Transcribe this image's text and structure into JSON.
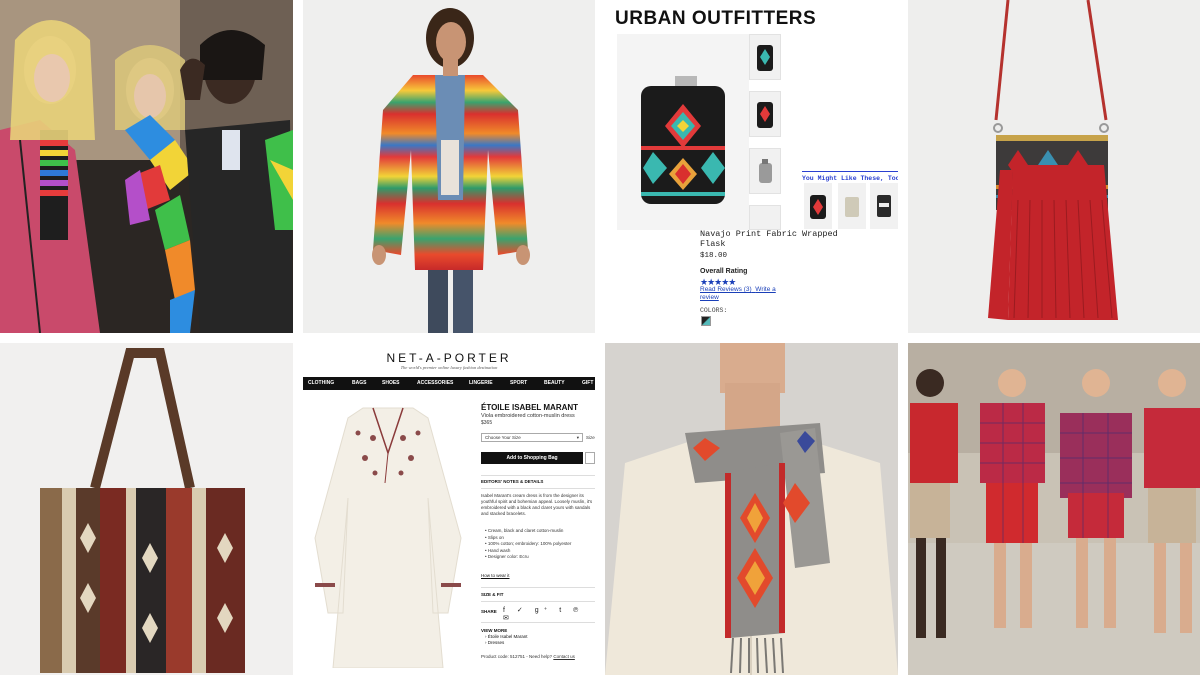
{
  "colors": {
    "uo_link_blue": "#1a3fb8",
    "nap_nav_bg": "#111111",
    "tote_stripe_red": "#7a2a22",
    "fringe_red": "#c3242a"
  },
  "urban_outfitters": {
    "logo": "URBAN OUTFITTERS",
    "product_name": "Navajo Print Fabric Wrapped Flask",
    "price": "$18.00",
    "rating_label": "Overall Rating",
    "stars": "★★★★★",
    "reviews_link": "Read Reviews (3)",
    "write_review_link": "Write a review",
    "colors_label": "COLORS:",
    "you_might_like": "You Might Like These, Too"
  },
  "net_a_porter": {
    "logo": "NET-A-PORTER",
    "tagline": "The world's premier online luxury fashion destination",
    "nav": [
      "CLOTHING",
      "BAGS",
      "SHOES",
      "ACCESSORIES",
      "LINGERIE",
      "SPORT",
      "BEAUTY",
      "GIFT"
    ],
    "brand": "ÉTOILE ISABEL MARANT",
    "description": "Viola embroidered cotton-muslin dress",
    "price": "$365",
    "size_select": "Choose Your Size",
    "size_label": "Size",
    "add_to_bag": "Add to Shopping Bag",
    "editors_notes": "EDITORS' NOTES & DETAILS",
    "body_text": "Isabel Marant's cream dress is from the designer its youthful spirit and bohemian appeal. Loosely muslin, it's embroidered with a black and claret yours with sandals and stacked bracelets.",
    "bullets": [
      "Cream, black and claret cotton-muslin",
      "Slips on",
      "100% cotton; embroidery: 100% polyester",
      "Hand wash",
      "Designer color: Ecru"
    ],
    "how_to_wear": "How to wear it",
    "size_fit": "SIZE & FIT",
    "share": "SHARE",
    "share_icons": "f ✓ g⁺ t ℗ ✉",
    "view_more": "VIEW MORE",
    "view_more_items": [
      "Étoile Isabel Marant",
      "Dresses"
    ],
    "product_code": "Product code: 512751 - Need help?",
    "contact_us": "Contact us"
  }
}
